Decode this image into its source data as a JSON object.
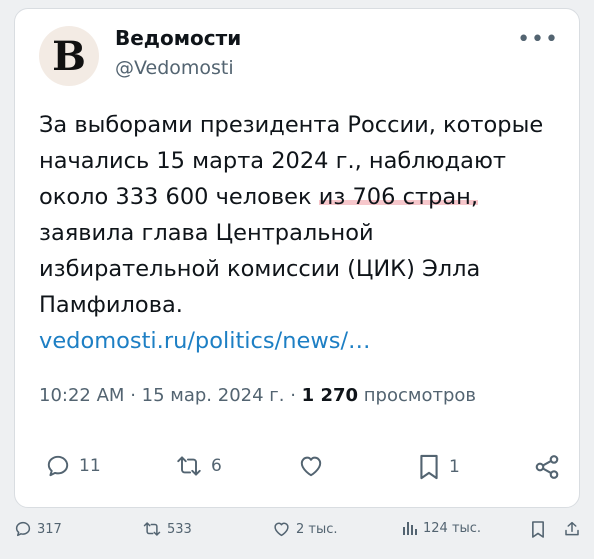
{
  "tweet": {
    "display_name": "Ведомости",
    "handle": "@Vedomosti",
    "avatar_letter": "B",
    "more_label": "•••",
    "text_lines": [
      "За выборами президента России, которые",
      "начались 15 марта 2024 г., наблюдают",
      "около 333 600 человек ",
      "из 706 стран,",
      "заявила глава Центральной",
      "избирательной комиссии (ЦИК) Элла",
      "Памфилова."
    ],
    "link": "vedomosti.ru/politics/news/…",
    "time": "10:22 AM",
    "date": "15 мар. 2024 г.",
    "views_count": "1 270",
    "views_label": "просмотров",
    "actions": {
      "replies": "11",
      "retweets": "6",
      "likes": "",
      "bookmarks": "1"
    }
  },
  "footer": {
    "replies": "317",
    "retweets": "533",
    "likes": "2 тыс.",
    "views": "124 тыс."
  },
  "colors": {
    "link": "#1d7fc4",
    "muted": "#536471",
    "highlight": "#ec828c"
  }
}
